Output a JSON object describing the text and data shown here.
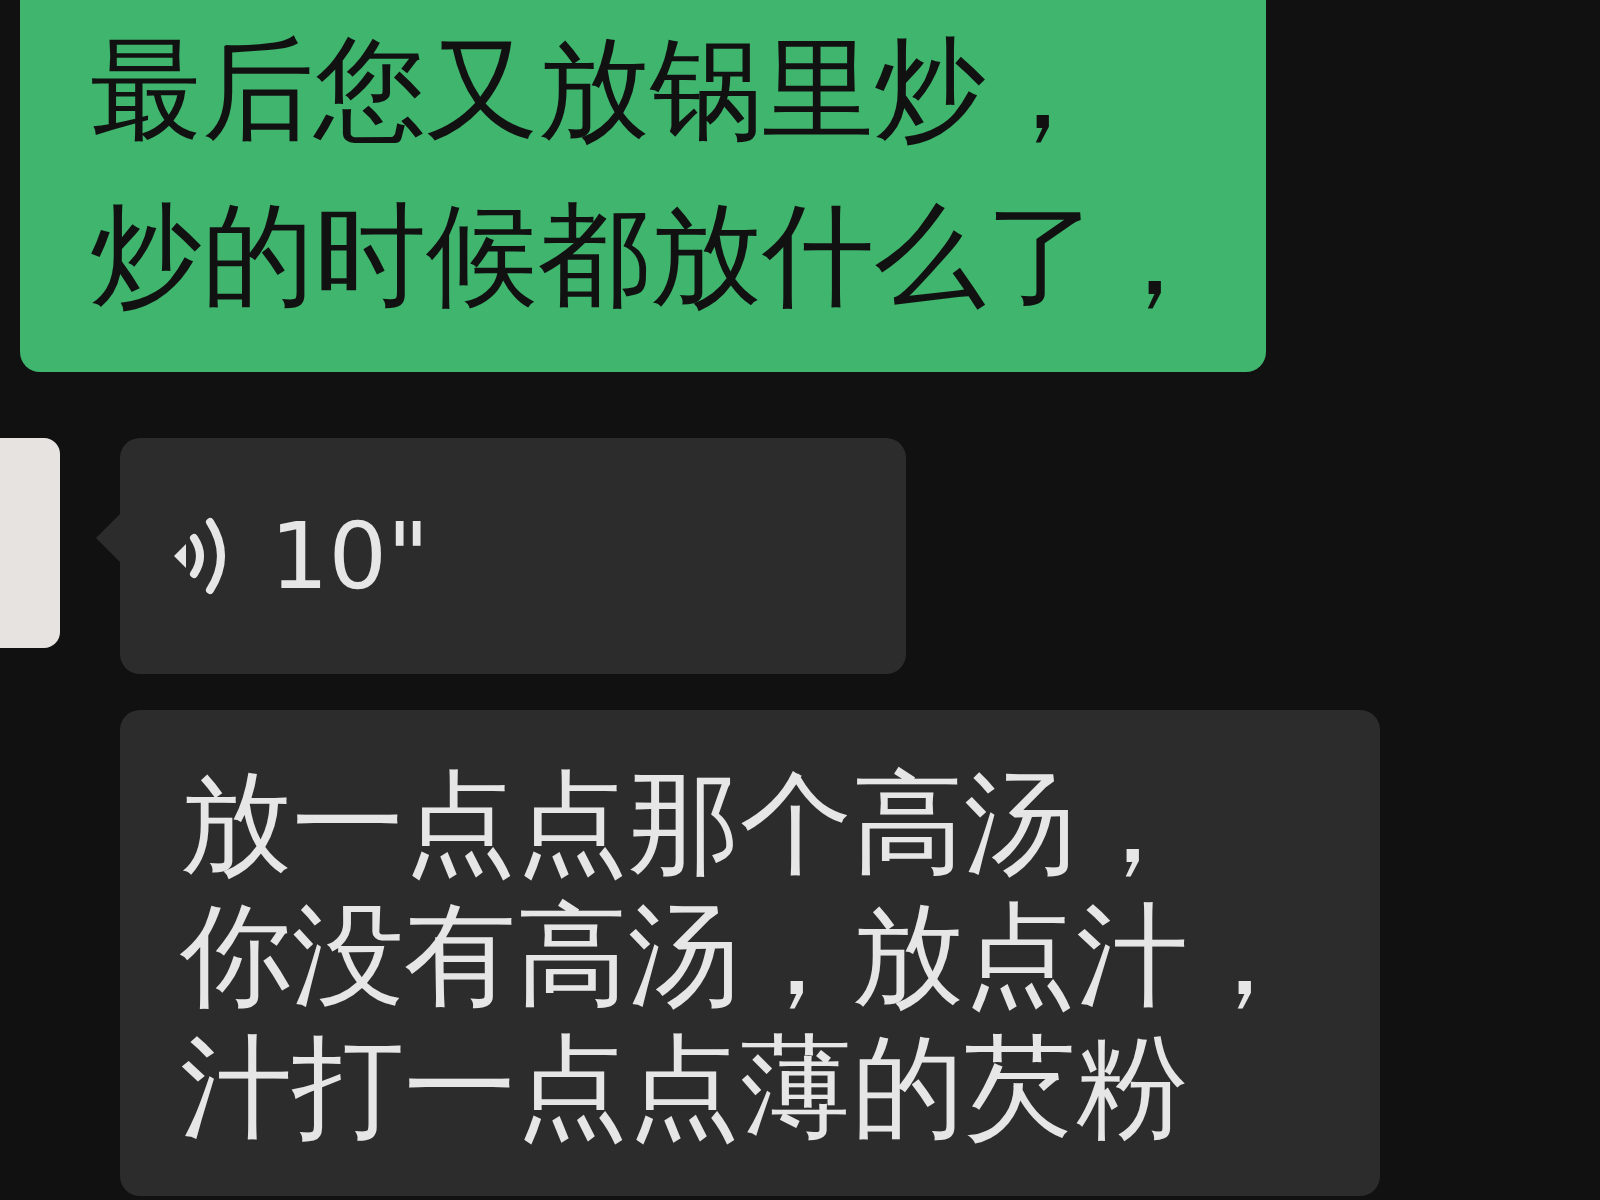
{
  "messages": [
    {
      "kind": "text",
      "outgoing": true,
      "avatar": false,
      "lines": [
        "最后您又放锅里炒，",
        "炒的时候都放什么了，"
      ]
    },
    {
      "kind": "voice",
      "outgoing": false,
      "avatar": true,
      "duration": "10\""
    },
    {
      "kind": "text",
      "outgoing": false,
      "avatar": false,
      "lines": [
        "放一点点那个高汤，",
        "你没有高汤，放点汁，",
        "汁打一点点薄的芡粉"
      ]
    }
  ]
}
